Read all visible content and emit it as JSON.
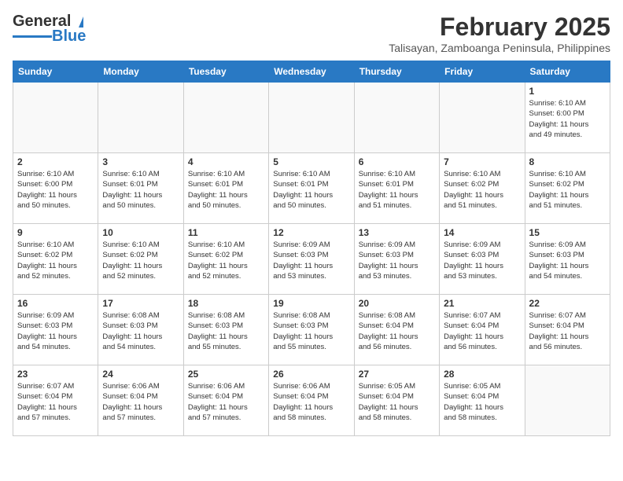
{
  "header": {
    "logo_line1": "General",
    "logo_line2": "Blue",
    "title": "February 2025",
    "subtitle": "Talisayan, Zamboanga Peninsula, Philippines"
  },
  "weekdays": [
    "Sunday",
    "Monday",
    "Tuesday",
    "Wednesday",
    "Thursday",
    "Friday",
    "Saturday"
  ],
  "weeks": [
    [
      {
        "day": "",
        "info": ""
      },
      {
        "day": "",
        "info": ""
      },
      {
        "day": "",
        "info": ""
      },
      {
        "day": "",
        "info": ""
      },
      {
        "day": "",
        "info": ""
      },
      {
        "day": "",
        "info": ""
      },
      {
        "day": "1",
        "info": "Sunrise: 6:10 AM\nSunset: 6:00 PM\nDaylight: 11 hours\nand 49 minutes."
      }
    ],
    [
      {
        "day": "2",
        "info": "Sunrise: 6:10 AM\nSunset: 6:00 PM\nDaylight: 11 hours\nand 50 minutes."
      },
      {
        "day": "3",
        "info": "Sunrise: 6:10 AM\nSunset: 6:01 PM\nDaylight: 11 hours\nand 50 minutes."
      },
      {
        "day": "4",
        "info": "Sunrise: 6:10 AM\nSunset: 6:01 PM\nDaylight: 11 hours\nand 50 minutes."
      },
      {
        "day": "5",
        "info": "Sunrise: 6:10 AM\nSunset: 6:01 PM\nDaylight: 11 hours\nand 50 minutes."
      },
      {
        "day": "6",
        "info": "Sunrise: 6:10 AM\nSunset: 6:01 PM\nDaylight: 11 hours\nand 51 minutes."
      },
      {
        "day": "7",
        "info": "Sunrise: 6:10 AM\nSunset: 6:02 PM\nDaylight: 11 hours\nand 51 minutes."
      },
      {
        "day": "8",
        "info": "Sunrise: 6:10 AM\nSunset: 6:02 PM\nDaylight: 11 hours\nand 51 minutes."
      }
    ],
    [
      {
        "day": "9",
        "info": "Sunrise: 6:10 AM\nSunset: 6:02 PM\nDaylight: 11 hours\nand 52 minutes."
      },
      {
        "day": "10",
        "info": "Sunrise: 6:10 AM\nSunset: 6:02 PM\nDaylight: 11 hours\nand 52 minutes."
      },
      {
        "day": "11",
        "info": "Sunrise: 6:10 AM\nSunset: 6:02 PM\nDaylight: 11 hours\nand 52 minutes."
      },
      {
        "day": "12",
        "info": "Sunrise: 6:09 AM\nSunset: 6:03 PM\nDaylight: 11 hours\nand 53 minutes."
      },
      {
        "day": "13",
        "info": "Sunrise: 6:09 AM\nSunset: 6:03 PM\nDaylight: 11 hours\nand 53 minutes."
      },
      {
        "day": "14",
        "info": "Sunrise: 6:09 AM\nSunset: 6:03 PM\nDaylight: 11 hours\nand 53 minutes."
      },
      {
        "day": "15",
        "info": "Sunrise: 6:09 AM\nSunset: 6:03 PM\nDaylight: 11 hours\nand 54 minutes."
      }
    ],
    [
      {
        "day": "16",
        "info": "Sunrise: 6:09 AM\nSunset: 6:03 PM\nDaylight: 11 hours\nand 54 minutes."
      },
      {
        "day": "17",
        "info": "Sunrise: 6:08 AM\nSunset: 6:03 PM\nDaylight: 11 hours\nand 54 minutes."
      },
      {
        "day": "18",
        "info": "Sunrise: 6:08 AM\nSunset: 6:03 PM\nDaylight: 11 hours\nand 55 minutes."
      },
      {
        "day": "19",
        "info": "Sunrise: 6:08 AM\nSunset: 6:03 PM\nDaylight: 11 hours\nand 55 minutes."
      },
      {
        "day": "20",
        "info": "Sunrise: 6:08 AM\nSunset: 6:04 PM\nDaylight: 11 hours\nand 56 minutes."
      },
      {
        "day": "21",
        "info": "Sunrise: 6:07 AM\nSunset: 6:04 PM\nDaylight: 11 hours\nand 56 minutes."
      },
      {
        "day": "22",
        "info": "Sunrise: 6:07 AM\nSunset: 6:04 PM\nDaylight: 11 hours\nand 56 minutes."
      }
    ],
    [
      {
        "day": "23",
        "info": "Sunrise: 6:07 AM\nSunset: 6:04 PM\nDaylight: 11 hours\nand 57 minutes."
      },
      {
        "day": "24",
        "info": "Sunrise: 6:06 AM\nSunset: 6:04 PM\nDaylight: 11 hours\nand 57 minutes."
      },
      {
        "day": "25",
        "info": "Sunrise: 6:06 AM\nSunset: 6:04 PM\nDaylight: 11 hours\nand 57 minutes."
      },
      {
        "day": "26",
        "info": "Sunrise: 6:06 AM\nSunset: 6:04 PM\nDaylight: 11 hours\nand 58 minutes."
      },
      {
        "day": "27",
        "info": "Sunrise: 6:05 AM\nSunset: 6:04 PM\nDaylight: 11 hours\nand 58 minutes."
      },
      {
        "day": "28",
        "info": "Sunrise: 6:05 AM\nSunset: 6:04 PM\nDaylight: 11 hours\nand 58 minutes."
      },
      {
        "day": "",
        "info": ""
      }
    ]
  ]
}
